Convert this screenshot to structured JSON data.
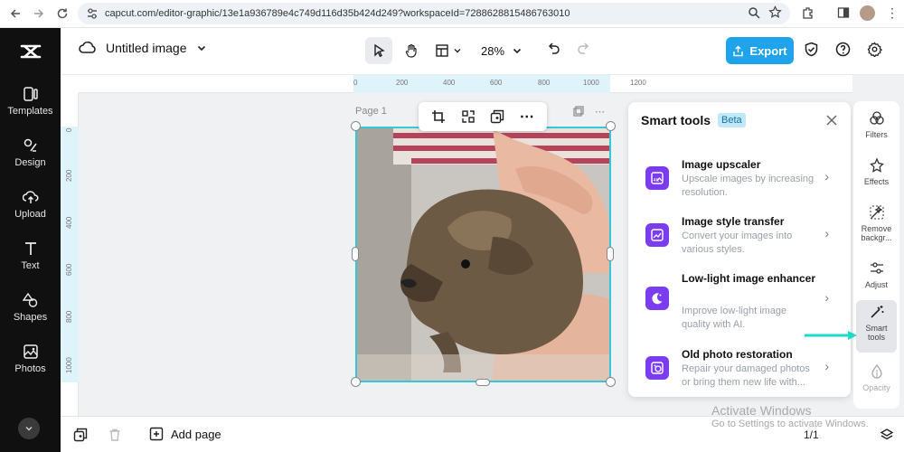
{
  "browser": {
    "url": "capcut.com/editor-graphic/13e1a936789e4c749d116d35b424d249?workspaceId=7288628815486763010"
  },
  "sidebar": {
    "items": [
      {
        "label": "Templates",
        "icon": "templates-icon"
      },
      {
        "label": "Design",
        "icon": "design-icon"
      },
      {
        "label": "Upload",
        "icon": "upload-icon"
      },
      {
        "label": "Text",
        "icon": "text-icon"
      },
      {
        "label": "Shapes",
        "icon": "shapes-icon"
      },
      {
        "label": "Photos",
        "icon": "photos-icon"
      }
    ]
  },
  "header": {
    "title": "Untitled image",
    "zoom": "28%",
    "export_label": "Export"
  },
  "ruler": {
    "top_labels": [
      "0",
      "200",
      "400",
      "600",
      "800",
      "1000",
      "1200"
    ],
    "left_labels": [
      "0",
      "200",
      "400",
      "600",
      "800",
      "1000"
    ]
  },
  "canvas": {
    "page_label": "Page 1"
  },
  "smart_tools": {
    "title": "Smart tools",
    "badge": "Beta",
    "items": [
      {
        "name": "Image upscaler",
        "desc": "Upscale images by increasing resolution."
      },
      {
        "name": "Image style transfer",
        "desc": "Convert your images into various styles."
      },
      {
        "name": "Low-light image enhancer",
        "desc": "Improve low-light image quality with AI."
      },
      {
        "name": "Old photo restoration",
        "desc": "Repair your damaged photos or bring them new life with..."
      }
    ]
  },
  "right_rail": {
    "items": [
      {
        "label": "Filters"
      },
      {
        "label": "Effects"
      },
      {
        "label": "Remove backgr..."
      },
      {
        "label": "Adjust"
      },
      {
        "label": "Smart tools"
      },
      {
        "label": "Opacity"
      }
    ]
  },
  "bottom": {
    "add_page": "Add page",
    "page_count": "1/1"
  },
  "watermark": {
    "line1": "Activate Windows",
    "line2": "Go to Settings to activate Windows."
  },
  "colors": {
    "accent": "#1fa4ec",
    "selection": "#33c7d9",
    "tool_icon": "#7b3cf0",
    "sidebar_bg": "#101010"
  }
}
